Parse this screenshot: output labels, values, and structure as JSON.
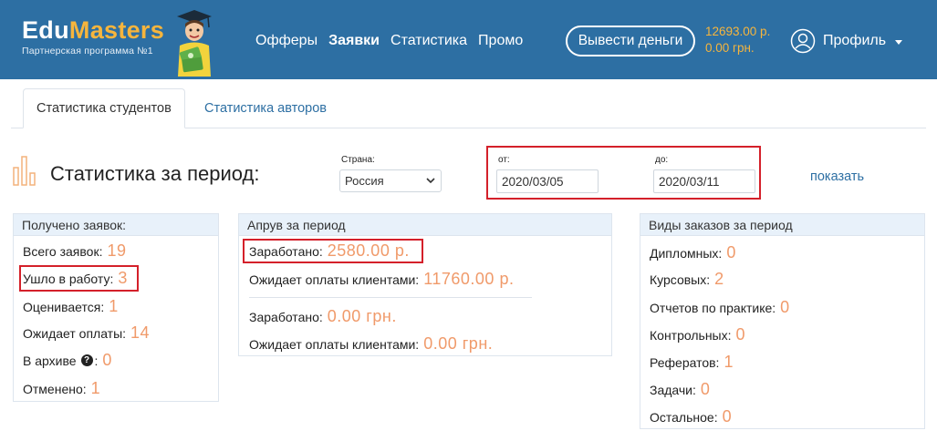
{
  "header": {
    "logo": {
      "part1": "Edu",
      "part2": "Masters",
      "subtitle": "Партнерская программа №1"
    },
    "nav": [
      {
        "label": "Офферы",
        "active": false
      },
      {
        "label": "Заявки",
        "active": true
      },
      {
        "label": "Статистика",
        "active": false
      },
      {
        "label": "Промо",
        "active": false
      }
    ],
    "withdraw_label": "Вывести деньги",
    "balance_rub": "12693.00 р.",
    "balance_uah": "0.00 грн.",
    "profile_label": "Профиль"
  },
  "tabs": [
    {
      "label": "Статистика студентов",
      "active": true
    },
    {
      "label": "Статистика авторов",
      "active": false
    }
  ],
  "filters": {
    "title": "Статистика за период:",
    "country_label": "Страна:",
    "country_value": "Россия",
    "from_label": "от:",
    "from_value": "2020/03/05",
    "to_label": "до:",
    "to_value": "2020/03/11",
    "show_label": "показать"
  },
  "received": {
    "title": "Получено заявок:",
    "rows": [
      {
        "label": "Всего заявок:",
        "value": "19"
      },
      {
        "label": "Ушло в работу:",
        "value": "3"
      },
      {
        "label": "Оценивается:",
        "value": "1"
      },
      {
        "label": "Ожидает оплаты:",
        "value": "14"
      },
      {
        "label": "В архиве",
        "suffix": ":",
        "value": "0"
      },
      {
        "label": "Отменено:",
        "value": "1"
      }
    ]
  },
  "approve": {
    "title": "Апрув за период",
    "rows": [
      {
        "label": "Заработано:",
        "value": "2580.00 р."
      },
      {
        "label": "Ожидает оплаты клиентами:",
        "value": "11760.00 р."
      },
      {
        "label": "Заработано:",
        "value": "0.00 грн."
      },
      {
        "label": "Ожидает оплаты клиентами:",
        "value": "0.00 грн."
      }
    ]
  },
  "orders": {
    "title": "Виды заказов за период",
    "rows": [
      {
        "label": "Дипломных:",
        "value": "0"
      },
      {
        "label": "Курсовых:",
        "value": "2"
      },
      {
        "label": "Отчетов по практике:",
        "value": "0"
      },
      {
        "label": "Контрольных:",
        "value": "0"
      },
      {
        "label": "Рефератов:",
        "value": "1"
      },
      {
        "label": "Задачи:",
        "value": "0"
      },
      {
        "label": "Остальное:",
        "value": "0"
      }
    ]
  },
  "colors": {
    "header_bg": "#2d6fa3",
    "accent_orange": "#f09a6a",
    "logo_gold": "#f6b53d",
    "highlight_red": "#d4202a",
    "link_blue": "#2d6fa3"
  }
}
